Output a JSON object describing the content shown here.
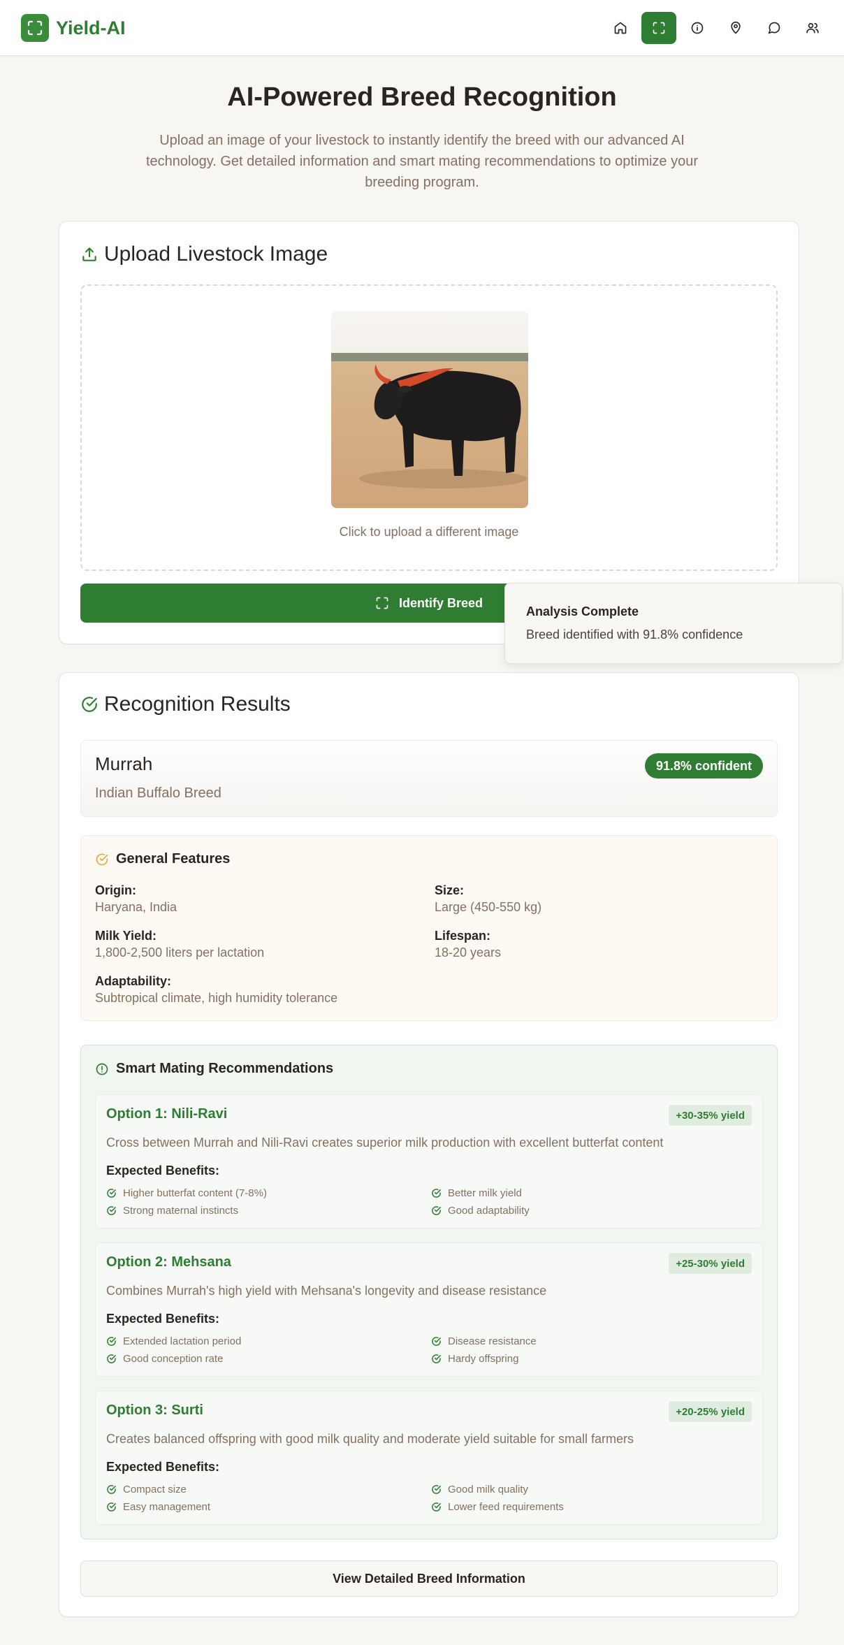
{
  "brand": {
    "name": "Yield-AI",
    "logo_icon": "scan-icon"
  },
  "nav": [
    {
      "icon": "home-icon",
      "active": false
    },
    {
      "icon": "scan-icon",
      "active": true
    },
    {
      "icon": "info-icon",
      "active": false
    },
    {
      "icon": "map-pin-icon",
      "active": false
    },
    {
      "icon": "chat-icon",
      "active": false
    },
    {
      "icon": "users-icon",
      "active": false
    }
  ],
  "hero": {
    "title": "AI-Powered Breed Recognition",
    "subtitle": "Upload an image of your livestock to instantly identify the breed with our advanced AI technology. Get detailed information and smart mating recommendations to optimize your breeding program."
  },
  "upload": {
    "title": "Upload Livestock Image",
    "hint": "Click to upload a different image",
    "button": "Identify Breed"
  },
  "toast": {
    "title": "Analysis Complete",
    "description": "Breed identified with 91.8% confidence"
  },
  "results": {
    "title": "Recognition Results",
    "breed": "Murrah",
    "breed_type": "Indian Buffalo Breed",
    "confidence_label": "91.8% confident",
    "features": {
      "title": "General Features",
      "origin_label": "Origin:",
      "origin": "Haryana, India",
      "size_label": "Size:",
      "size": "Large (450-550 kg)",
      "milk_label": "Milk Yield:",
      "milk": "1,800-2,500 liters per lactation",
      "lifespan_label": "Lifespan:",
      "lifespan": "18-20 years",
      "adapt_label": "Adaptability:",
      "adapt": "Subtropical climate, high humidity tolerance"
    },
    "mating": {
      "title": "Smart Mating Recommendations",
      "benefits_label": "Expected Benefits:",
      "options": [
        {
          "title": "Option 1: Nili-Ravi",
          "badge": "+30-35% yield",
          "description": "Cross between Murrah and Nili-Ravi creates superior milk production with excellent butterfat content",
          "benefits": [
            "Higher butterfat content (7-8%)",
            "Better milk yield",
            "Strong maternal instincts",
            "Good adaptability"
          ]
        },
        {
          "title": "Option 2: Mehsana",
          "badge": "+25-30% yield",
          "description": "Combines Murrah's high yield with Mehsana's longevity and disease resistance",
          "benefits": [
            "Extended lactation period",
            "Disease resistance",
            "Good conception rate",
            "Hardy offspring"
          ]
        },
        {
          "title": "Option 3: Surti",
          "badge": "+20-25% yield",
          "description": "Creates balanced offspring with good milk quality and moderate yield suitable for small farmers",
          "benefits": [
            "Compact size",
            "Good milk quality",
            "Easy management",
            "Lower feed requirements"
          ]
        }
      ]
    },
    "details_button": "View Detailed Breed Information"
  },
  "colors": {
    "primary": "#2e7d32",
    "muted_text": "#857062",
    "features_bg": "#fdfaf3",
    "mating_bg": "#f0f6f0"
  }
}
